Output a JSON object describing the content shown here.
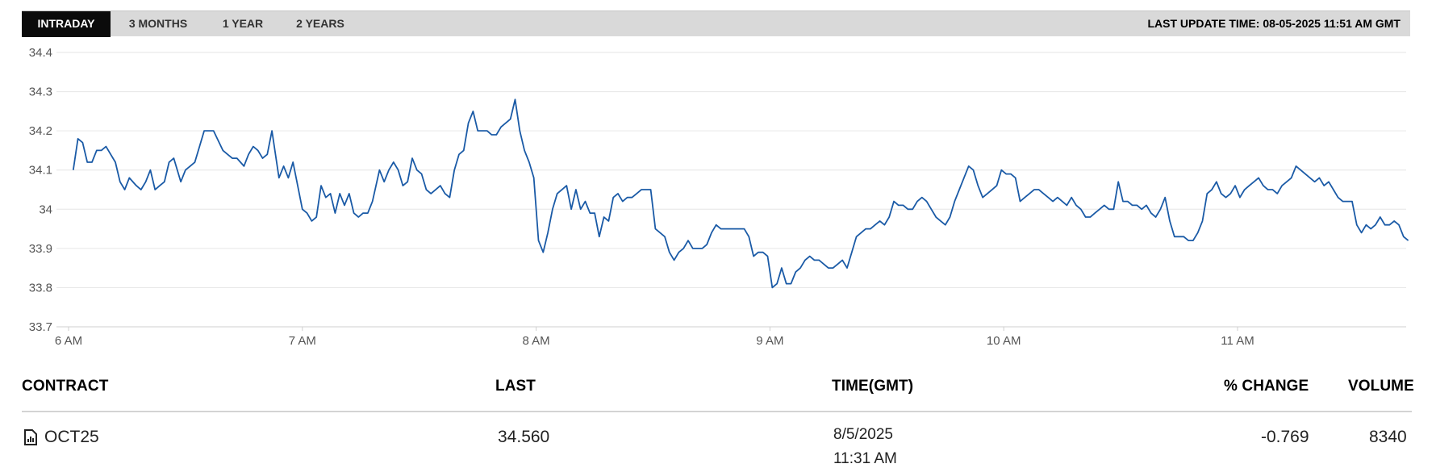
{
  "tabs": [
    {
      "label": "INTRADAY",
      "active": true
    },
    {
      "label": "3 MONTHS",
      "active": false
    },
    {
      "label": "1 YEAR",
      "active": false
    },
    {
      "label": "2 YEARS",
      "active": false
    }
  ],
  "last_update": "LAST UPDATE TIME: 08-05-2025 11:51 AM GMT",
  "colors": {
    "line": "#1a5aa6",
    "active_tab": "#0b0b0b",
    "tab_bar": "#d9d9d9"
  },
  "chart_data": {
    "type": "line",
    "title": "",
    "xlabel": "",
    "ylabel": "",
    "y_ticks": [
      "34.4",
      "34.3",
      "34.2",
      "34.1",
      "34",
      "33.9",
      "33.8",
      "33.7"
    ],
    "ylim": [
      33.7,
      34.4
    ],
    "x_ticks": [
      "6 AM",
      "7 AM",
      "8 AM",
      "9 AM",
      "10 AM",
      "11 AM"
    ],
    "x_unit": "hours GMT",
    "xlim": [
      6.0,
      11.73
    ],
    "grid": true,
    "legend": "none",
    "series": [
      {
        "x": [
          6.02,
          6.04,
          6.06,
          6.08,
          6.1,
          6.12,
          6.14,
          6.16,
          6.18,
          6.2,
          6.22,
          6.24,
          6.26,
          6.29,
          6.31,
          6.33,
          6.35,
          6.37,
          6.39,
          6.41,
          6.43,
          6.45,
          6.48,
          6.5,
          6.52,
          6.54,
          6.56,
          6.58,
          6.62,
          6.66,
          6.68,
          6.7,
          6.72,
          6.75,
          6.77,
          6.79,
          6.81,
          6.83,
          6.85,
          6.87,
          6.9,
          6.92,
          6.94,
          6.96,
          6.98,
          7.0,
          7.02,
          7.04,
          7.06,
          7.08,
          7.1,
          7.12,
          7.14,
          7.16,
          7.18,
          7.2,
          7.22,
          7.24,
          7.26,
          7.28,
          7.3,
          7.33,
          7.35,
          7.37,
          7.39,
          7.41,
          7.43,
          7.45,
          7.47,
          7.49,
          7.51,
          7.53,
          7.55,
          7.57,
          7.59,
          7.61,
          7.63,
          7.65,
          7.67,
          7.69,
          7.71,
          7.73,
          7.75,
          7.77,
          7.79,
          7.81,
          7.83,
          7.85,
          7.87,
          7.89,
          7.91,
          7.93,
          7.95,
          7.97,
          7.99,
          8.01,
          8.03,
          8.05,
          8.07,
          8.09,
          8.11,
          8.13,
          8.15,
          8.17,
          8.19,
          8.21,
          8.23,
          8.25,
          8.27,
          8.29,
          8.31,
          8.33,
          8.35,
          8.37,
          8.39,
          8.41,
          8.43,
          8.45,
          8.47,
          8.49,
          8.51,
          8.53,
          8.55,
          8.57,
          8.59,
          8.61,
          8.63,
          8.65,
          8.67,
          8.69,
          8.71,
          8.73,
          8.75,
          8.77,
          8.79,
          8.81,
          8.83,
          8.85,
          8.87,
          8.89,
          8.91,
          8.93,
          8.95,
          8.97,
          8.99,
          9.01,
          9.03,
          9.05,
          9.07,
          9.09,
          9.11,
          9.13,
          9.15,
          9.17,
          9.19,
          9.21,
          9.23,
          9.25,
          9.27,
          9.29,
          9.31,
          9.33,
          9.35,
          9.37,
          9.39,
          9.41,
          9.43,
          9.45,
          9.47,
          9.49,
          9.51,
          9.53,
          9.55,
          9.57,
          9.59,
          9.61,
          9.63,
          9.65,
          9.67,
          9.69,
          9.71,
          9.73,
          9.75,
          9.77,
          9.79,
          9.81,
          9.83,
          9.85,
          9.87,
          9.89,
          9.91,
          9.93,
          9.95,
          9.97,
          9.99,
          10.01,
          10.03,
          10.05,
          10.07,
          10.09,
          10.11,
          10.13,
          10.15,
          10.17,
          10.19,
          10.21,
          10.23,
          10.25,
          10.27,
          10.29,
          10.31,
          10.33,
          10.35,
          10.37,
          10.39,
          10.41,
          10.43,
          10.45,
          10.47,
          10.49,
          10.51,
          10.53,
          10.55,
          10.57,
          10.59,
          10.61,
          10.63,
          10.65,
          10.67,
          10.69,
          10.71,
          10.73,
          10.75,
          10.77,
          10.79,
          10.81,
          10.83,
          10.85,
          10.87,
          10.89,
          10.91,
          10.93,
          10.95,
          10.97,
          10.99,
          11.01,
          11.03,
          11.05,
          11.07,
          11.09,
          11.11,
          11.13,
          11.15,
          11.17,
          11.19,
          11.21,
          11.23,
          11.25,
          11.27,
          11.29,
          11.31,
          11.33,
          11.35,
          11.37,
          11.39,
          11.41,
          11.43,
          11.45,
          11.47,
          11.49,
          11.51,
          11.53,
          11.55,
          11.57,
          11.59,
          11.61,
          11.63,
          11.65,
          11.67,
          11.69,
          11.71,
          11.73
        ],
        "values": [
          34.1,
          34.18,
          34.17,
          34.12,
          34.12,
          34.15,
          34.15,
          34.16,
          34.14,
          34.12,
          34.07,
          34.05,
          34.08,
          34.06,
          34.05,
          34.07,
          34.1,
          34.05,
          34.06,
          34.07,
          34.12,
          34.13,
          34.07,
          34.1,
          34.11,
          34.12,
          34.16,
          34.2,
          34.2,
          34.15,
          34.14,
          34.13,
          34.13,
          34.11,
          34.14,
          34.16,
          34.15,
          34.13,
          34.14,
          34.2,
          34.08,
          34.11,
          34.08,
          34.12,
          34.06,
          34.0,
          33.99,
          33.97,
          33.98,
          34.06,
          34.03,
          34.04,
          33.99,
          34.04,
          34.01,
          34.04,
          33.99,
          33.98,
          33.99,
          33.99,
          34.02,
          34.1,
          34.07,
          34.1,
          34.12,
          34.1,
          34.06,
          34.07,
          34.13,
          34.1,
          34.09,
          34.05,
          34.04,
          34.05,
          34.06,
          34.04,
          34.03,
          34.1,
          34.14,
          34.15,
          34.22,
          34.25,
          34.2,
          34.2,
          34.2,
          34.19,
          34.19,
          34.21,
          34.22,
          34.23,
          34.28,
          34.2,
          34.15,
          34.12,
          34.08,
          33.92,
          33.89,
          33.94,
          34.0,
          34.04,
          34.05,
          34.06,
          34.0,
          34.05,
          34.0,
          34.02,
          33.99,
          33.99,
          33.93,
          33.98,
          33.97,
          34.03,
          34.04,
          34.02,
          34.03,
          34.03,
          34.04,
          34.05,
          34.05,
          34.05,
          33.95,
          33.94,
          33.93,
          33.89,
          33.87,
          33.89,
          33.9,
          33.92,
          33.9,
          33.9,
          33.9,
          33.91,
          33.94,
          33.96,
          33.95,
          33.95,
          33.95,
          33.95,
          33.95,
          33.95,
          33.93,
          33.88,
          33.89,
          33.89,
          33.88,
          33.8,
          33.81,
          33.85,
          33.81,
          33.81,
          33.84,
          33.85,
          33.87,
          33.88,
          33.87,
          33.87,
          33.86,
          33.85,
          33.85,
          33.86,
          33.87,
          33.85,
          33.89,
          33.93,
          33.94,
          33.95,
          33.95,
          33.96,
          33.97,
          33.96,
          33.98,
          34.02,
          34.01,
          34.01,
          34.0,
          34.0,
          34.02,
          34.03,
          34.02,
          34.0,
          33.98,
          33.97,
          33.96,
          33.98,
          34.02,
          34.05,
          34.08,
          34.11,
          34.1,
          34.06,
          34.03,
          34.04,
          34.05,
          34.06,
          34.1,
          34.09,
          34.09,
          34.08,
          34.02,
          34.03,
          34.04,
          34.05,
          34.05,
          34.04,
          34.03,
          34.02,
          34.03,
          34.02,
          34.01,
          34.03,
          34.01,
          34.0,
          33.98,
          33.98,
          33.99,
          34.0,
          34.01,
          34.0,
          34.0,
          34.07,
          34.02,
          34.02,
          34.01,
          34.01,
          34.0,
          34.01,
          33.99,
          33.98,
          34.0,
          34.03,
          33.97,
          33.93,
          33.93,
          33.93,
          33.92,
          33.92,
          33.94,
          33.97,
          34.04,
          34.05,
          34.07,
          34.04,
          34.03,
          34.04,
          34.06,
          34.03,
          34.05,
          34.06,
          34.07,
          34.08,
          34.06,
          34.05,
          34.05,
          34.04,
          34.06,
          34.07,
          34.08,
          34.11,
          34.1,
          34.09,
          34.08,
          34.07,
          34.08,
          34.06,
          34.07,
          34.05,
          34.03,
          34.02,
          34.02,
          34.02,
          33.96,
          33.94,
          33.96,
          33.95,
          33.96,
          33.98,
          33.96,
          33.96,
          33.97,
          33.96,
          33.93,
          33.92
        ]
      }
    ]
  },
  "table": {
    "headers": {
      "contract": "CONTRACT",
      "last": "LAST",
      "time": "TIME(GMT)",
      "change": "% CHANGE",
      "volume": "VOLUME"
    },
    "rows": [
      {
        "icon": "report-document-icon",
        "contract": "OCT25",
        "last": "34.560",
        "date": "8/5/2025",
        "time": "11:31 AM",
        "change": "-0.769",
        "volume": "8340"
      }
    ]
  }
}
